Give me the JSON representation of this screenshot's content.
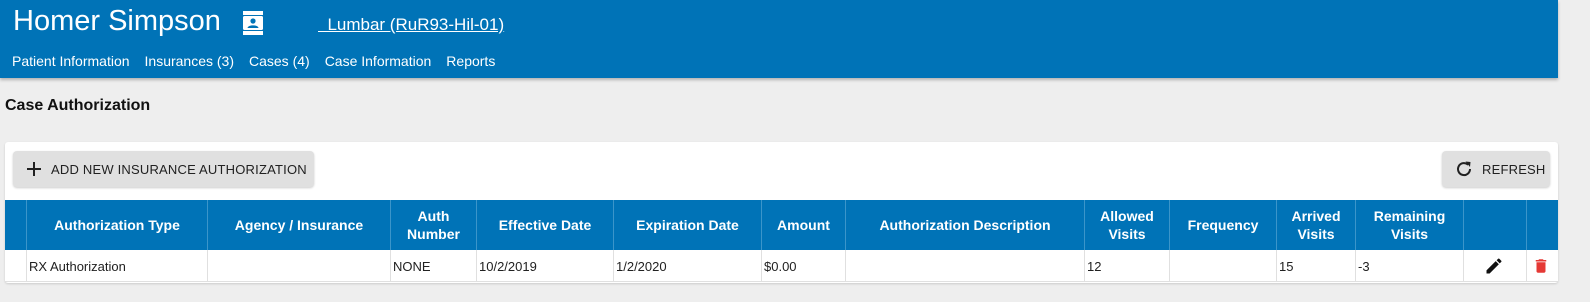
{
  "header": {
    "patient_name": "Homer Simpson",
    "case_link": "  Lumbar (RuR93-Hil-01)",
    "nav": [
      "Patient Information",
      "Insurances (3)",
      "Cases (4)",
      "Case Information",
      "Reports"
    ]
  },
  "page": {
    "title": "Case Authorization"
  },
  "toolbar": {
    "add_label": "ADD NEW INSURANCE AUTHORIZATION",
    "refresh_label": "REFRESH"
  },
  "table": {
    "columns": [
      "Authorization Type",
      "Agency / Insurance",
      "Auth Number",
      "Effective Date",
      "Expiration Date",
      "Amount",
      "Authorization Description",
      "Allowed Visits",
      "Frequency",
      "Arrived Visits",
      "Remaining Visits"
    ],
    "rows": [
      [
        "RX Authorization",
        "",
        "NONE",
        "10/2/2019",
        "1/2/2020",
        "$0.00",
        "",
        "12",
        "",
        "15",
        "-3"
      ]
    ]
  },
  "colors": {
    "primary": "#0073b7",
    "delete": "#e53935",
    "background": "#eeeeee"
  },
  "icons": {
    "contact": "contact-card-icon",
    "add": "plus-icon",
    "refresh": "refresh-icon",
    "edit": "pencil-icon",
    "delete": "trash-icon"
  }
}
